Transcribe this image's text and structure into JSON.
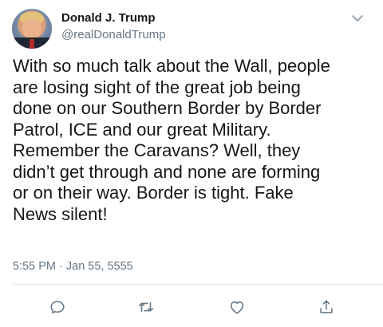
{
  "tweet": {
    "display_name": "Donald J. Trump",
    "handle": "@realDonaldTrump",
    "text": "With so much talk about the Wall, people\nare losing sight of the great job being\ndone on our Southern Border by Border\nPatrol, ICE and our great Military.\nRemember the Caravans? Well, they\ndidn’t get through and none are forming\nor on their way. Border is tight. Fake\nNews silent!",
    "timestamp": "5:55 PM · Jan 55, 5555"
  },
  "icons": {
    "menu": "chevron-down-icon",
    "reply": "reply-icon",
    "retweet": "retweet-icon",
    "like": "heart-icon",
    "share": "share-icon"
  },
  "colors": {
    "text": "#14171a",
    "secondary": "#657786",
    "icon": "#657786",
    "divider": "#e1e8ed"
  }
}
